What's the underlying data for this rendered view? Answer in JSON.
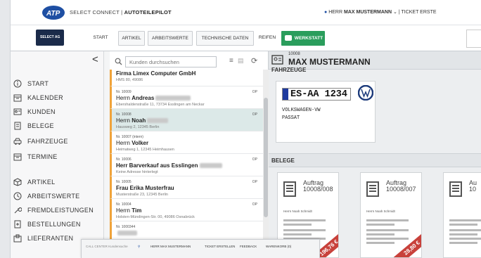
{
  "header": {
    "brand_prefix": "SELECT CONNECT",
    "brand_name": "AUTOTEILEPILOT",
    "user_prefix": "HERR",
    "user_name": "MAX MUSTERMANN",
    "ticket": "TICKET ERSTE"
  },
  "nav": {
    "shop_label": "SELECT AG",
    "items": [
      {
        "label": "START",
        "style": "plain"
      },
      {
        "label": "ARTIKEL",
        "style": "button"
      },
      {
        "label": "ARBEITSWERTE",
        "style": "button"
      },
      {
        "label": "TECHNISCHE DATEN",
        "style": "button"
      },
      {
        "label": "REIFEN",
        "style": "plain"
      },
      {
        "label": "WERKSTATT",
        "style": "active"
      }
    ]
  },
  "sidebar": {
    "collapse": "<",
    "items": [
      {
        "label": "START",
        "icon": "info-icon"
      },
      {
        "label": "KALENDER",
        "icon": "calendar-icon"
      },
      {
        "label": "KUNDEN",
        "icon": "contacts-icon"
      },
      {
        "label": "BELEGE",
        "icon": "document-icon"
      },
      {
        "label": "FAHRZEUGE",
        "icon": "car-icon"
      },
      {
        "label": "TERMINE",
        "icon": "calendar-icon"
      },
      {
        "label": "ARTIKEL",
        "icon": "box-icon"
      },
      {
        "label": "ARBEITSWERTE",
        "icon": "clock-icon"
      },
      {
        "label": "FREMDLEISTUNGEN",
        "icon": "wrench-icon"
      },
      {
        "label": "BESTELLUNGEN",
        "icon": "order-icon"
      },
      {
        "label": "LIEFERANTEN",
        "icon": "supplier-icon"
      }
    ]
  },
  "customers": {
    "search_placeholder": "Kunden durchsuchen",
    "rows": [
      {
        "nr": "",
        "op": "",
        "name_prefix": "",
        "name": "Firma Limex Computer GmbH",
        "address": "HMS 80, 49086",
        "selected": false
      },
      {
        "nr": "Nr. 10009",
        "op": "OP",
        "name_prefix": "Herrn",
        "name": "Andreas",
        "address": "Ebershaldenstraße 11, 73734 Esslingen am Neckar",
        "selected": false
      },
      {
        "nr": "Nr. 10008",
        "op": "OP",
        "name_prefix": "Herrn",
        "name": "Noah",
        "address": "Hausweg 2, 12345 Berlin",
        "selected": true
      },
      {
        "nr": "Nr. 10007 (intern)",
        "op": "",
        "name_prefix": "Herrn",
        "name": "Volker",
        "address": "Heimatweg 1, 12345 Heimhausen",
        "selected": false
      },
      {
        "nr": "Nr. 10006",
        "op": "OP",
        "name_prefix": "",
        "name": "Herr Barverkauf aus Esslingen",
        "address": "Keine Adresse hinterlegt",
        "selected": false
      },
      {
        "nr": "Nr. 10005",
        "op": "OP",
        "name_prefix": "",
        "name": "Frau Erika Musterfrau",
        "address": "Musterstraße 23, 12345 Berlin",
        "selected": false
      },
      {
        "nr": "Nr. 10004",
        "op": "OP",
        "name_prefix": "Herrn",
        "name": "Tim",
        "address": "Holsten-Mündingen-Str. 00, 49086 Osnabrück",
        "selected": false
      },
      {
        "nr": "Nr. 1000344",
        "op": "",
        "name_prefix": "",
        "name": "",
        "address": "",
        "selected": false
      }
    ]
  },
  "detail": {
    "customer_nr": "10008",
    "customer_name": "MAX MUSTERMANN",
    "vehicles_title": "FAHRZEUGE",
    "vehicle": {
      "plate": "ES-AA 1234",
      "make": "VOLKSWAGEN-VW",
      "model": "PASSAT"
    },
    "belege_title": "BELEGE",
    "documents": [
      {
        "title": "Auftrag",
        "number": "10008/008",
        "amount": "196,76 €",
        "recipient": "Herrn Noah Schmidt"
      },
      {
        "title": "Auftrag",
        "number": "10008/007",
        "amount": "28,80 €",
        "recipient": "Herrn Noah Schmidt"
      },
      {
        "title": "Au",
        "number": "10",
        "amount": "",
        "recipient": ""
      }
    ]
  },
  "footer_bar": {
    "call_center": "CALL CENTER Kundensuche",
    "user": "HERR MAX MUSTERMANN",
    "ticket": "TICKET ERSTELLEN",
    "feedback": "FEEDBACK",
    "cart": "WARENKORB (0)"
  },
  "colors": {
    "accent": "#2a9d5c",
    "brand": "#1e4fa3",
    "row_marker": "#f0a33a",
    "ribbon": "#c8413b"
  }
}
